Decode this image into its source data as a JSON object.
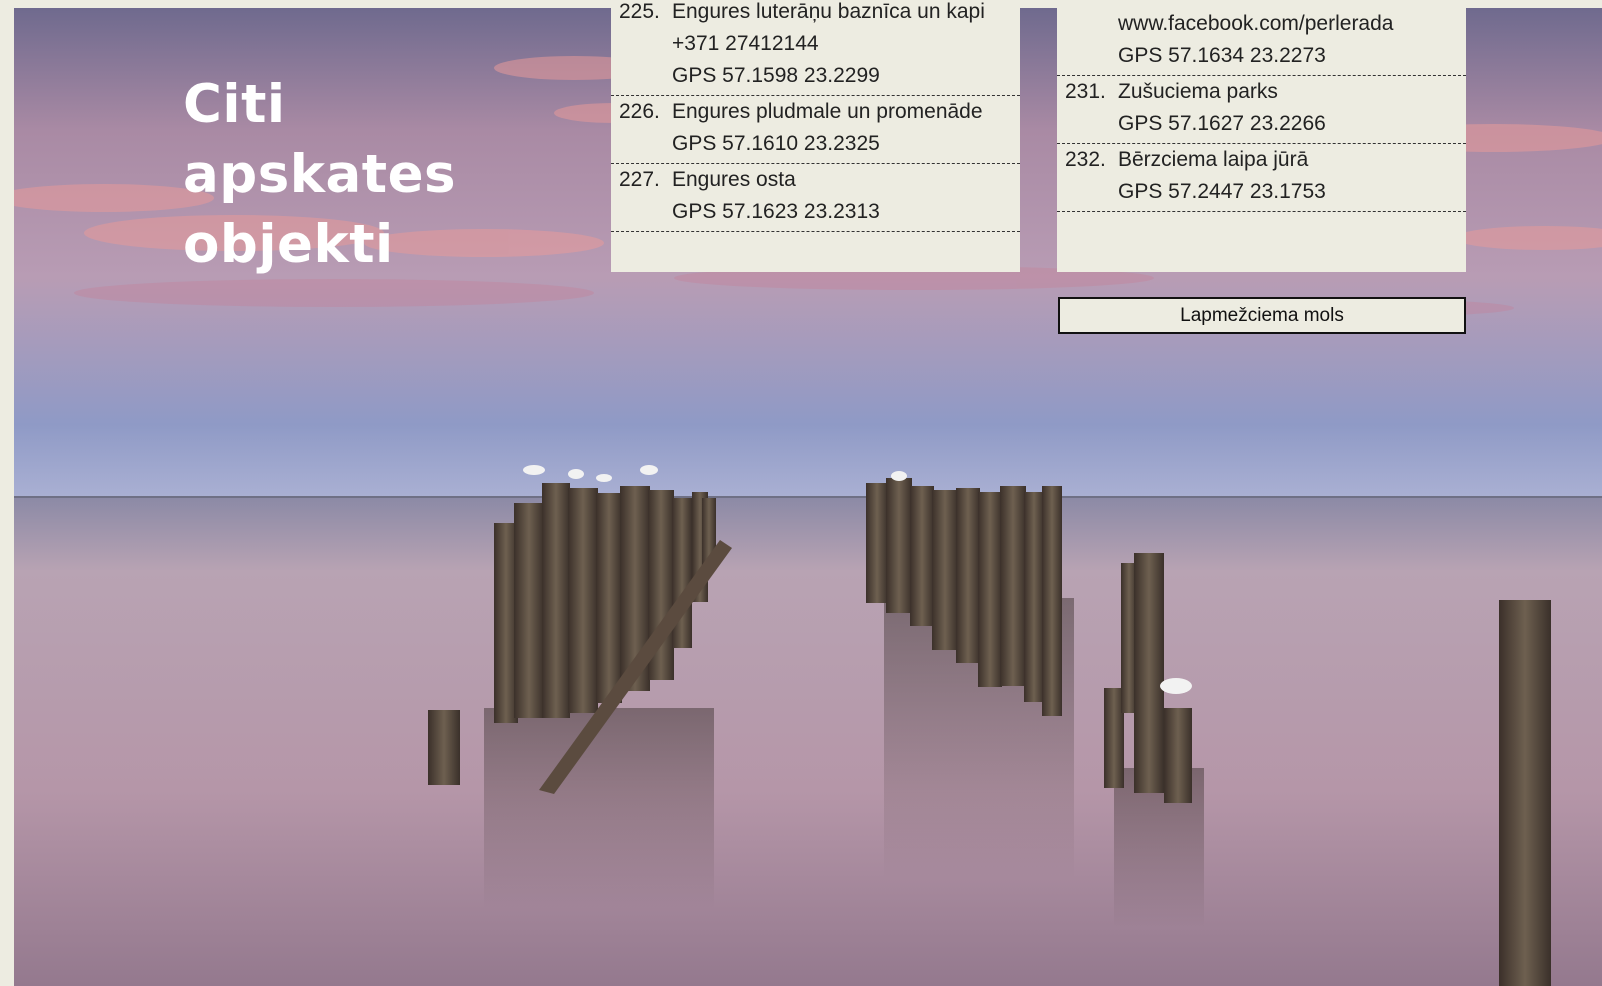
{
  "heading": {
    "lines": [
      "Citi",
      "apskates",
      "objekti"
    ]
  },
  "list_left": [
    {
      "number": "225.",
      "name": "Engures luterāņu baznīca un kapi",
      "phone": "+371 27412144",
      "gps": "GPS 57.1598 23.2299"
    },
    {
      "number": "226.",
      "name": "Engures pludmale un promenāde",
      "gps": "GPS 57.1610 23.2325"
    },
    {
      "number": "227.",
      "name": "Engures osta",
      "gps": "GPS 57.1623 23.2313"
    }
  ],
  "list_right": [
    {
      "website": "www.facebook.com/perlerada",
      "gps": "GPS 57.1634 23.2273"
    },
    {
      "number": "231.",
      "name": "Zušuciema parks",
      "gps": "GPS 57.1627 23.2266"
    },
    {
      "number": "232.",
      "name": "Bērzciema laipa jūrā",
      "gps": "GPS 57.2447 23.1753"
    }
  ],
  "photo_caption": "Lapmežciema mols",
  "colors": {
    "panel": "#edece1",
    "heading": "#ffffff",
    "text": "#222222"
  }
}
